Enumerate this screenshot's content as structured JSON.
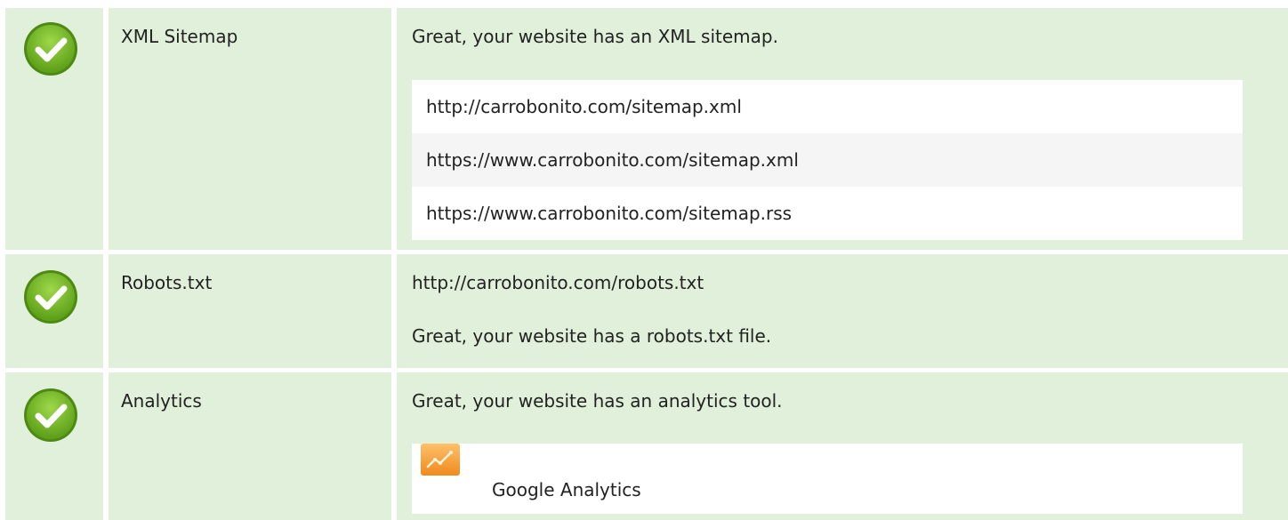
{
  "rows": [
    {
      "label": "XML Sitemap",
      "status_icon": "check-circle-icon",
      "message": "Great, your website has an XML sitemap.",
      "urls": [
        "http://carrobonito.com/sitemap.xml",
        "https://www.carrobonito.com/sitemap.xml",
        "https://www.carrobonito.com/sitemap.rss"
      ]
    },
    {
      "label": "Robots.txt",
      "status_icon": "check-circle-icon",
      "url": "http://carrobonito.com/robots.txt",
      "message": "Great, your website has a robots.txt file."
    },
    {
      "label": "Analytics",
      "status_icon": "check-circle-icon",
      "message": "Great, your website has an analytics tool.",
      "tool": {
        "icon": "google-analytics-icon",
        "name": "Google Analytics"
      }
    }
  ],
  "colors": {
    "row_background": "#e1f0da",
    "check_green": "#7cbd2a",
    "list_background": "#ffffff",
    "list_alt_background": "#f5f5f5",
    "analytics_orange": "#f7a53c"
  }
}
